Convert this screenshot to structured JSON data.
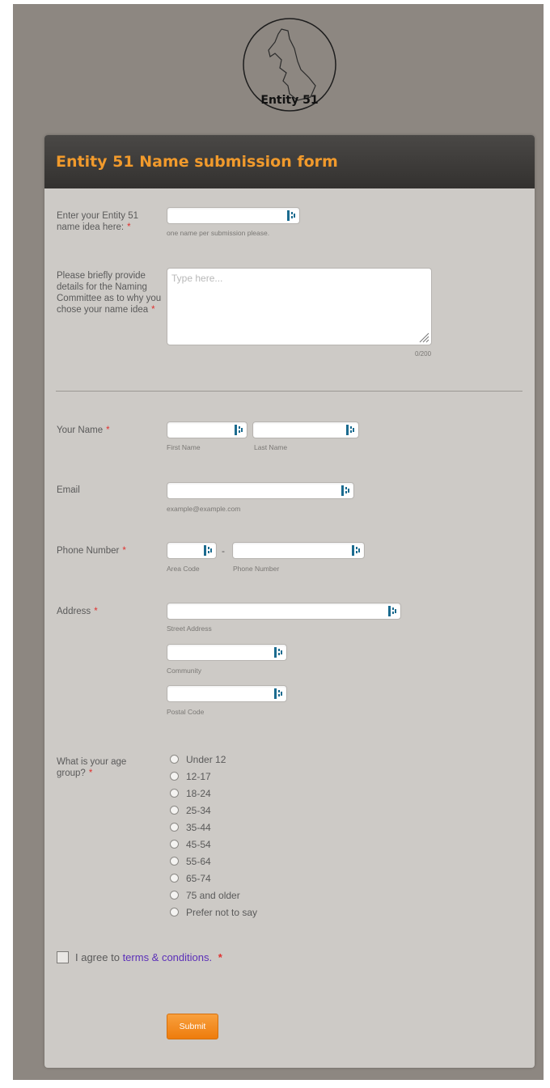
{
  "logo": {
    "text": "Entity 51"
  },
  "form": {
    "title": "Entity 51 Name submission form",
    "name_idea": {
      "label": "Enter your Entity 51 name idea here:",
      "required": "*",
      "sublabel": "one name per submission please.",
      "value": ""
    },
    "details": {
      "label": "Please briefly provide details for the Naming Committee as to why you chose your name idea",
      "required": "*",
      "placeholder": "Type here...",
      "counter": "0/200"
    },
    "your_name": {
      "label": "Your Name",
      "required": "*",
      "first_sub": "First Name",
      "last_sub": "Last Name"
    },
    "email": {
      "label": "Email",
      "sublabel": "example@example.com"
    },
    "phone": {
      "label": "Phone Number",
      "required": "*",
      "separator": "-",
      "area_sub": "Area Code",
      "number_sub": "Phone Number"
    },
    "address": {
      "label": "Address",
      "required": "*",
      "street_sub": "Street Address",
      "community_sub": "Community",
      "postal_sub": "Postal Code"
    },
    "age": {
      "label": "What is your age group?",
      "required": "*",
      "options": [
        "Under 12",
        "12-17",
        "18-24",
        "25-34",
        "35-44",
        "45-54",
        "55-64",
        "65-74",
        "75 and older",
        "Prefer not to say"
      ]
    },
    "terms": {
      "prefix": "I agree to",
      "link": "terms & conditions.",
      "required": "*"
    },
    "submit_label": "Submit"
  }
}
